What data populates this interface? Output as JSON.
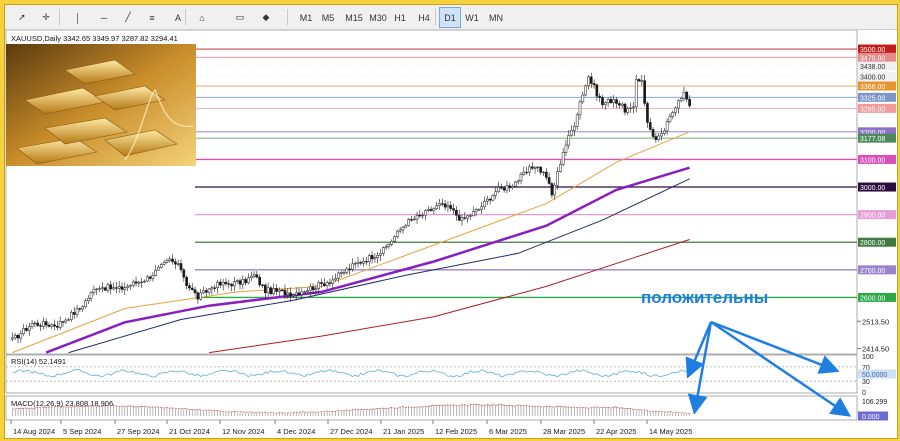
{
  "toolbar": {
    "timeframes": [
      "M1",
      "M5",
      "M15",
      "M30",
      "H1",
      "H4",
      "D1",
      "W1",
      "MN"
    ],
    "active": "D1",
    "icons": [
      "cursor-icon",
      "crosshair-icon",
      "vertical-line-icon",
      "horizontal-line-icon",
      "trendline-icon",
      "fibonacci-icon",
      "text-icon",
      "label-icon",
      "rectangle-icon",
      "shapes-icon"
    ]
  },
  "colors": {
    "candle": "#1a1a1a",
    "ma_short": "#e8a23c",
    "ma_mid": "#8a1fbf",
    "ma_long": "#1f2a6b",
    "ma_200": "#b01e1e",
    "rsi": "#5aaedc",
    "macd": "#c85050",
    "annotation": "#1e7fe0",
    "border": "#f6d23a"
  },
  "chart_data": {
    "type": "candlestick",
    "symbol_line": "XAUUSD,Daily  3342.65  3349.97  3287.82  3294.41",
    "x_labels": [
      "14 Aug 2024",
      "5 Sep 2024",
      "27 Sep 2024",
      "21 Oct 2024",
      "12 Nov 2024",
      "4 Dec 2024",
      "27 Dec 2024",
      "21 Jan 2025",
      "12 Feb 2025",
      "6 Mar 2025",
      "28 Mar 2025",
      "22 Apr 2025",
      "14 May 2025"
    ],
    "y_ticks": [
      2414.5,
      2513.5
    ],
    "ylim": [
      2395,
      3540
    ],
    "levels": [
      {
        "value": 3500,
        "label": "3500.00",
        "bg": "#c61a1a",
        "fg": "#ffffff"
      },
      {
        "value": 3470,
        "label": "3470.00",
        "bg": "#e58a8a",
        "fg": "#ffffff"
      },
      {
        "value": 3438,
        "label": "3438.00",
        "bg": "#f0f0f0",
        "fg": "#333333"
      },
      {
        "value": 3400,
        "label": "3400.00",
        "bg": "#f0f0f0",
        "fg": "#333333"
      },
      {
        "value": 3366,
        "label": "3366.00",
        "bg": "#e89530",
        "fg": "#ffffff"
      },
      {
        "value": 3325,
        "label": "3325.00",
        "bg": "#7d95c9",
        "fg": "#ffffff"
      },
      {
        "value": 3285,
        "label": "3285.00",
        "bg": "#f29a9a",
        "fg": "#ffffff"
      },
      {
        "value": 3200,
        "label": "3200.00",
        "bg": "#8c72c7",
        "fg": "#ffffff"
      },
      {
        "value": 3177.08,
        "label": "3177.08",
        "bg": "#4f8a5e",
        "fg": "#ffffff"
      },
      {
        "value": 3100,
        "label": "3100.00",
        "bg": "#d94fb8",
        "fg": "#ffffff"
      },
      {
        "value": 3000,
        "label": "3000.00",
        "bg": "#2b0d3d",
        "fg": "#ffffff"
      },
      {
        "value": 2900,
        "label": "2900.00",
        "bg": "#e69cd6",
        "fg": "#ffffff"
      },
      {
        "value": 2800,
        "label": "2800.00",
        "bg": "#3f7b42",
        "fg": "#ffffff"
      },
      {
        "value": 2700,
        "label": "2700.00",
        "bg": "#9a84cc",
        "fg": "#ffffff"
      },
      {
        "value": 2600,
        "label": "2600.00",
        "bg": "#2ea84a",
        "fg": "#ffffff"
      }
    ],
    "waypoints": [
      {
        "i": 0,
        "p": 2445
      },
      {
        "i": 7,
        "p": 2505
      },
      {
        "i": 16,
        "p": 2500
      },
      {
        "i": 24,
        "p": 2560
      },
      {
        "i": 30,
        "p": 2640
      },
      {
        "i": 38,
        "p": 2630
      },
      {
        "i": 48,
        "p": 2670
      },
      {
        "i": 56,
        "p": 2735
      },
      {
        "i": 60,
        "p": 2705
      },
      {
        "i": 62,
        "p": 2650
      },
      {
        "i": 66,
        "p": 2600
      },
      {
        "i": 72,
        "p": 2645
      },
      {
        "i": 82,
        "p": 2655
      },
      {
        "i": 86,
        "p": 2680
      },
      {
        "i": 90,
        "p": 2625
      },
      {
        "i": 96,
        "p": 2620
      },
      {
        "i": 100,
        "p": 2615
      },
      {
        "i": 108,
        "p": 2640
      },
      {
        "i": 114,
        "p": 2665
      },
      {
        "i": 122,
        "p": 2720
      },
      {
        "i": 132,
        "p": 2770
      },
      {
        "i": 140,
        "p": 2870
      },
      {
        "i": 146,
        "p": 2900
      },
      {
        "i": 152,
        "p": 2935
      },
      {
        "i": 156,
        "p": 2920
      },
      {
        "i": 160,
        "p": 2880
      },
      {
        "i": 166,
        "p": 2920
      },
      {
        "i": 172,
        "p": 2985
      },
      {
        "i": 178,
        "p": 3010
      },
      {
        "i": 182,
        "p": 3045
      },
      {
        "i": 186,
        "p": 3080
      },
      {
        "i": 190,
        "p": 3040
      },
      {
        "i": 192,
        "p": 2970
      },
      {
        "i": 196,
        "p": 3130
      },
      {
        "i": 200,
        "p": 3230
      },
      {
        "i": 202,
        "p": 3310
      },
      {
        "i": 205,
        "p": 3400
      },
      {
        "i": 207,
        "p": 3360
      },
      {
        "i": 210,
        "p": 3300
      },
      {
        "i": 214,
        "p": 3320
      },
      {
        "i": 218,
        "p": 3280
      },
      {
        "i": 221,
        "p": 3280
      },
      {
        "i": 222,
        "p": 3390
      },
      {
        "i": 224,
        "p": 3390
      },
      {
        "i": 226,
        "p": 3230
      },
      {
        "i": 229,
        "p": 3170
      },
      {
        "i": 231,
        "p": 3185
      },
      {
        "i": 234,
        "p": 3250
      },
      {
        "i": 237,
        "p": 3320
      },
      {
        "i": 239,
        "p": 3340
      },
      {
        "i": 241,
        "p": 3294
      }
    ],
    "ma": [
      {
        "name": "ma-short",
        "color_key": "ma_short",
        "width": 1,
        "points": [
          [
            0,
            2400
          ],
          [
            40,
            2560
          ],
          [
            80,
            2620
          ],
          [
            110,
            2640
          ],
          [
            150,
            2790
          ],
          [
            190,
            2940
          ],
          [
            215,
            3090
          ],
          [
            241,
            3200
          ]
        ]
      },
      {
        "name": "ma-mid",
        "color_key": "ma_mid",
        "width": 2.5,
        "points": [
          [
            12,
            2400
          ],
          [
            40,
            2510
          ],
          [
            70,
            2570
          ],
          [
            110,
            2620
          ],
          [
            150,
            2730
          ],
          [
            190,
            2860
          ],
          [
            215,
            2990
          ],
          [
            241,
            3070
          ]
        ]
      },
      {
        "name": "ma-long",
        "color_key": "ma_long",
        "width": 1,
        "points": [
          [
            20,
            2400
          ],
          [
            60,
            2520
          ],
          [
            100,
            2590
          ],
          [
            140,
            2680
          ],
          [
            180,
            2760
          ],
          [
            210,
            2880
          ],
          [
            241,
            3030
          ]
        ]
      },
      {
        "name": "ma-200",
        "color_key": "ma_200",
        "width": 1,
        "points": [
          [
            70,
            2400
          ],
          [
            110,
            2460
          ],
          [
            150,
            2530
          ],
          [
            190,
            2640
          ],
          [
            220,
            2740
          ],
          [
            241,
            2810
          ]
        ]
      }
    ],
    "rsi": {
      "label": "RSI(14) 52.1491",
      "levels": [
        100,
        70,
        50,
        30,
        0
      ],
      "current": 50
    },
    "macd": {
      "label": "MACD(12,26,9) 23.808 18.906",
      "value_label": "106.299",
      "zero_label": "0.000"
    },
    "annotation": {
      "text": "положительны"
    }
  }
}
